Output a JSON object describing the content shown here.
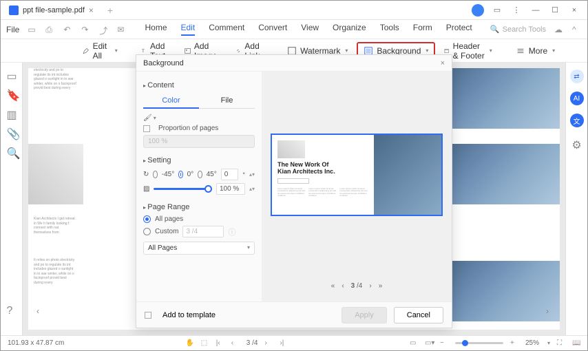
{
  "titlebar": {
    "tab_name": "ppt file-sample.pdf"
  },
  "menubar": {
    "file": "File",
    "tabs": [
      "Home",
      "Edit",
      "Comment",
      "Convert",
      "View",
      "Organize",
      "Tools",
      "Form",
      "Protect"
    ],
    "active_index": 1,
    "search_placeholder": "Search Tools"
  },
  "toolbar": {
    "edit_all": "Edit All",
    "add_text": "Add Text",
    "add_image": "Add Image",
    "add_link": "Add Link",
    "watermark": "Watermark",
    "background": "Background",
    "header_footer": "Header & Footer",
    "more": "More"
  },
  "dialog": {
    "title": "Background",
    "content_h": "Content",
    "tab_color": "Color",
    "tab_file": "File",
    "prop_pages": "Proportion of pages",
    "prop_value": "100 %",
    "setting_h": "Setting",
    "rot_neg45": "-45°",
    "rot_0": "0°",
    "rot_45": "45°",
    "rot_custom": "0",
    "opacity": "100 %",
    "range_h": "Page Range",
    "all_pages": "All pages",
    "custom": "Custom",
    "custom_range": "3 /4",
    "select_all": "All Pages",
    "add_template": "Add to template",
    "apply": "Apply",
    "cancel": "Cancel",
    "pager_current": "3",
    "pager_total": "/4"
  },
  "preview": {
    "title1": "The New Work Of",
    "title2": "Kian Architects Inc."
  },
  "statusbar": {
    "dims": "101.93 x 47.87 cm",
    "page": "3 /4",
    "zoom": "25%"
  }
}
